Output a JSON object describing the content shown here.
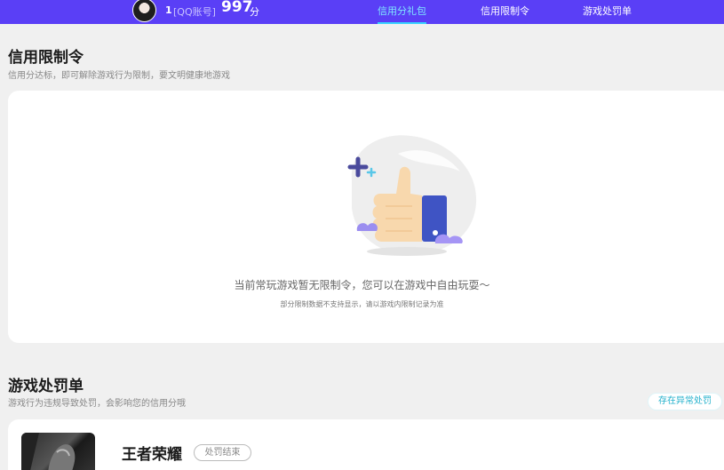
{
  "header": {
    "account_id": "1",
    "account_tag": "[QQ账号]",
    "score": "997",
    "score_unit": "分",
    "tabs": [
      {
        "label": "信用分礼包",
        "active": true
      },
      {
        "label": "信用限制令",
        "active": false
      },
      {
        "label": "游戏处罚单",
        "active": false
      }
    ]
  },
  "restriction": {
    "title": "信用限制令",
    "subtitle": "信用分达标，即可解除游戏行为限制，要文明健康地游戏",
    "empty_message": "当前常玩游戏暂无限制令，您可以在游戏中自由玩耍～",
    "empty_note": "部分限制数据不支持显示，请以游戏内限制记录为准"
  },
  "penalty": {
    "title": "游戏处罚单",
    "subtitle": "游戏行为违规导致处罚，会影响您的信用分哦",
    "abnormal_button": "存在异常处罚",
    "items": [
      {
        "game": "王者荣耀",
        "status": "处罚结束"
      }
    ]
  },
  "colors": {
    "topbar": "#5a3ff6",
    "tab_active": "#7fe7ff",
    "accent_teal": "#23b1cc"
  }
}
